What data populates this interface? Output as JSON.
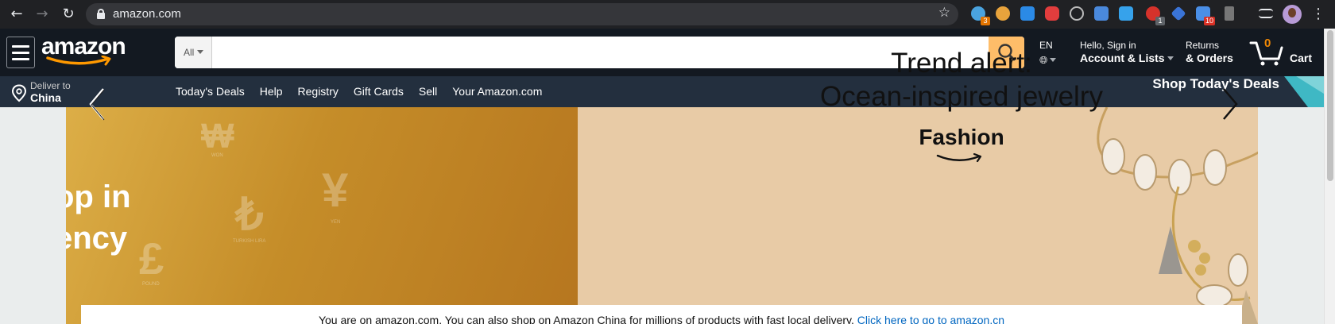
{
  "browser": {
    "url": "amazon.com",
    "extension_badges": {
      "ext1": "3",
      "ext9": "1",
      "ext12": "10"
    }
  },
  "header": {
    "search_dept": "All",
    "search_placeholder": "",
    "lang": "EN",
    "account_line1": "Hello, Sign in",
    "account_line2": "Account & Lists",
    "orders_line1": "Returns",
    "orders_line2": "& Orders",
    "cart_count": "0",
    "cart_label": "Cart"
  },
  "subnav": {
    "deliver_line1": "Deliver to",
    "deliver_line2": "China",
    "links": [
      "Today's Deals",
      "Help",
      "Registry",
      "Gift Cards",
      "Sell",
      "Your Amazon.com"
    ],
    "promo": "Shop Today's Deals"
  },
  "hero": {
    "left_text": "op in\nency",
    "currency_labels": [
      "WON",
      "YEN",
      "TURKISH LIRA",
      "POUND"
    ],
    "title": "Trend alert:\nOcean-inspired jewelry",
    "brand": "Fashion"
  },
  "notice": {
    "text": "You are on amazon.com. You can also shop on Amazon China for millions of products with fast local delivery. ",
    "link": "Click here to go to amazon.cn"
  },
  "colors": {
    "nav_belt": "#131921",
    "nav_main": "#232f3e",
    "search_button": "#febd69",
    "cart_count": "#f08804",
    "link": "#0066c0"
  }
}
